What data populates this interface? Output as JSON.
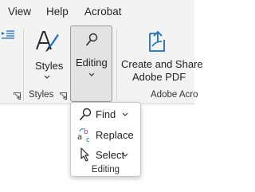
{
  "menu": {
    "items": [
      "View",
      "Help",
      "Acrobat"
    ]
  },
  "ribbon": {
    "styles_button": {
      "label": "Styles"
    },
    "styles_group": {
      "label": "Styles"
    },
    "editing_button": {
      "label": "Editing"
    },
    "acrobat_button": {
      "line1": "Create and Share",
      "line2": "Adobe PDF"
    },
    "acrobat_group": {
      "label": "Adobe Acro"
    }
  },
  "editing_dropdown": {
    "items": [
      {
        "label": "Find",
        "icon": "search-icon"
      },
      {
        "label": "Replace",
        "icon": "replace-icon"
      },
      {
        "label": "Select",
        "icon": "cursor-icon"
      }
    ],
    "footer": "Editing"
  },
  "colors": {
    "accent": "#1a6fc9",
    "ribbon_bg": "#f3f3f3"
  }
}
